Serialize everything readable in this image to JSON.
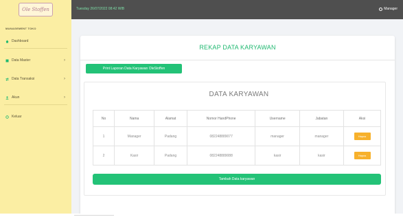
{
  "brand": {
    "logo_text": "Ole Stoffen"
  },
  "topbar": {
    "datetime": "Tuesday 26/07/2022 08:42 WIB",
    "user_label": "Manager"
  },
  "sidebar": {
    "heading": "MANAGEMENT TOKO",
    "items": [
      {
        "label": "Dashboard",
        "icon": "home-icon",
        "color": "#1fb870"
      },
      {
        "label": "Data Master",
        "icon": "database-icon",
        "color": "#1fb870"
      },
      {
        "label": "Data Transaksi",
        "icon": "exchange-icon",
        "color": "#1fb870"
      },
      {
        "label": "Akun",
        "icon": "user-icon",
        "color": "#1fb870"
      },
      {
        "label": "Keluar",
        "icon": "logout-icon",
        "color": "#1fb870"
      }
    ]
  },
  "main": {
    "title": "REKAP DATA KARYAWAN",
    "print_button": "Print Laporan Data Karyawan OleStoffen",
    "table_title": "DATA KARYAWAN",
    "columns": [
      "No",
      "Nama",
      "Alamat",
      "Nomor HandPhone",
      "Username",
      "Jabatan",
      "Aksi"
    ],
    "rows": [
      {
        "no": "1",
        "nama": "Manager",
        "alamat": "Padang",
        "hp": "082248889077",
        "username": "manager",
        "jabatan": "manager",
        "aksi": "Hapus"
      },
      {
        "no": "2",
        "nama": "Kasir",
        "alamat": "Padang",
        "hp": "082248889088",
        "username": "kasir",
        "jabatan": "kasir",
        "aksi": "Hapus"
      }
    ],
    "add_button": "Tambah Data karyawan"
  },
  "colors": {
    "accent_green": "#23c277",
    "sidebar_bg": "#fbeea3",
    "topbar_bg": "#4f4f4f",
    "action_orange": "#f7b12c"
  }
}
